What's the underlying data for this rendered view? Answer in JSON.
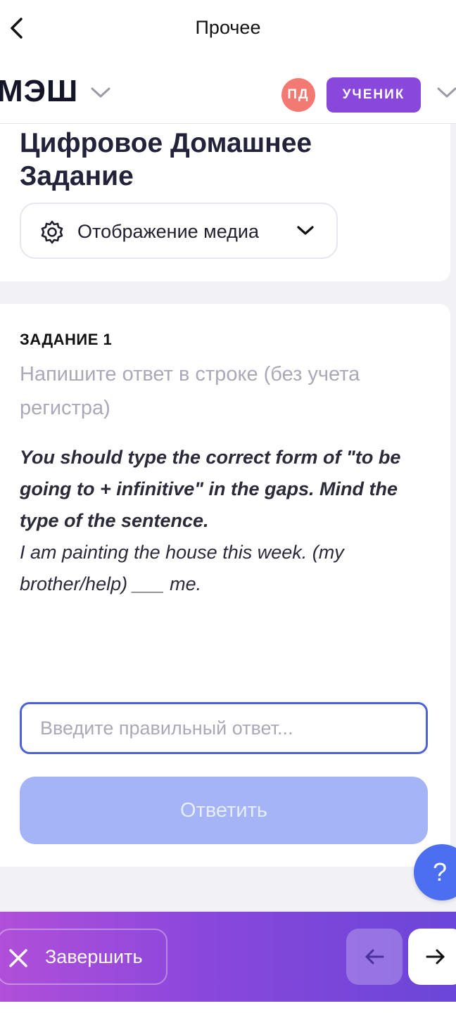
{
  "topbar": {
    "title": "Прочее",
    "back_icon": "chevron-left-icon"
  },
  "header": {
    "logo": "МЭШ",
    "avatar_initials": "ПД",
    "role": "УЧЕНИК",
    "colors": {
      "avatar": "#f27a73",
      "role_badge": "#8a47dc"
    }
  },
  "page": {
    "title": "Цифровое Домашнее Задание",
    "media_select_label": "Отображение медиа"
  },
  "task": {
    "label": "ЗАДАНИЕ 1",
    "hint": "Напишите ответ в строке (без учета регистра)",
    "instruction": "You should type the correct form of \"to be going to + infinitive\" in the gaps. Mind the type of the sentence.",
    "sentence": "I am painting the house this week. (my brother/help) ___ me.",
    "input_placeholder": "Введите правильный ответ...",
    "input_value": "",
    "submit_label": "Ответить"
  },
  "help": {
    "label": "?"
  },
  "bottombar": {
    "finish_label": "Завершить",
    "colors": {
      "gradient_start": "#b04fd9",
      "gradient_end": "#6a46d8"
    }
  },
  "accent_colors": {
    "input_border": "#4b62d8",
    "submit_disabled": "#a4b4f6",
    "help_fab": "#4b6ff0"
  }
}
